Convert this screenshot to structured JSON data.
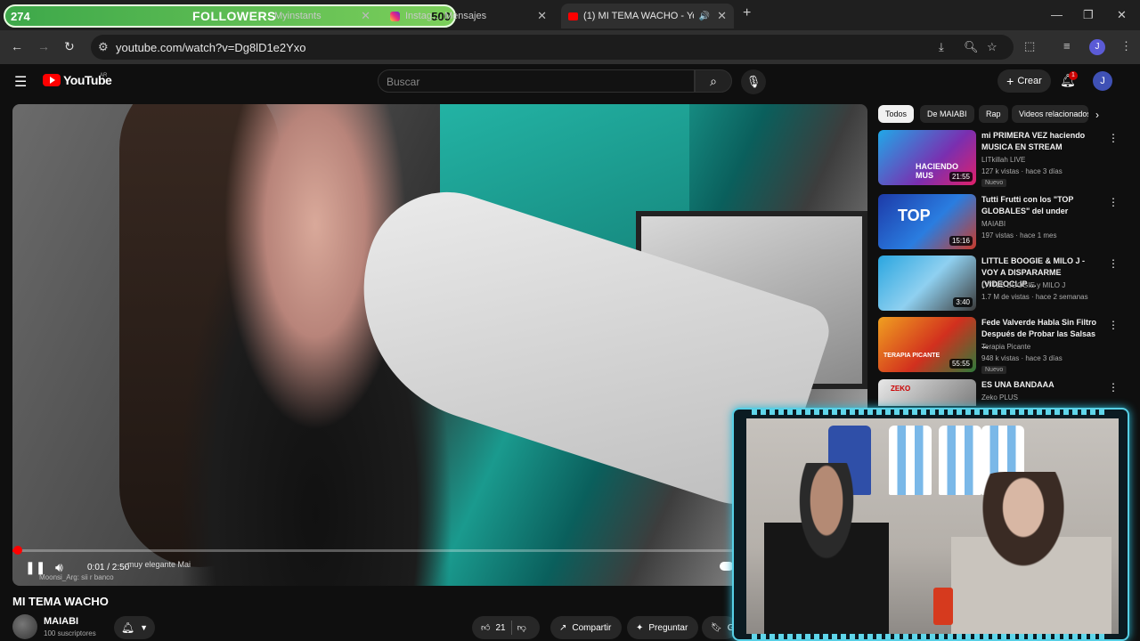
{
  "overlay": {
    "followers_count": "274",
    "followers_label": "FOLLOWERS",
    "followers_goal": "500"
  },
  "tabs": [
    {
      "title": "Myinstants",
      "active": false
    },
    {
      "title": "Instagram • Mensajes",
      "display": "Instag… Mensajes",
      "active": false
    },
    {
      "title": "(1) MI TEMA WACHO - YouTube",
      "display": "(1) MI TEMA WACHO - You",
      "active": true
    }
  ],
  "browser": {
    "url": "youtube.com/watch?v=Dg8lD1e2Yxo",
    "profile_initial": "J"
  },
  "youtube": {
    "logo_text": "YouTube",
    "country": "AR",
    "search_placeholder": "Buscar",
    "create_label": "Crear",
    "notif_count": "1",
    "avatar_initial": "J"
  },
  "player": {
    "time": "0:01 / 2:50",
    "progress_fraction": 0.006,
    "chat_line1": "…muy elegante Mai",
    "chat_line2": "Moonsi_Arg: sii r banco"
  },
  "video": {
    "title": "MI TEMA WACHO",
    "channel": "MAIABI",
    "subscribers": "100 suscriptores",
    "likes": "21",
    "share_label": "Compartir",
    "ask_label": "Preguntar",
    "save_label": "Gu"
  },
  "chips": [
    "Todos",
    "De MAIABI",
    "Rap",
    "Videos relacionados"
  ],
  "recommendations": [
    {
      "title": "mi PRIMERA VEZ haciendo MUSICA EN STREAM",
      "channel": "LITkillah LIVE",
      "meta": "127 k vistas · hace 3 días",
      "badge": "Nuevo",
      "duration": "21:55",
      "thumb_text": "HACIENDO MUS"
    },
    {
      "title": "Tutti Frutti con los \"TOP GLOBALES\" del under",
      "channel": "MAIABI",
      "meta": "197 vistas · hace 1 mes",
      "badge": "",
      "duration": "15:16",
      "thumb_text": "TOP"
    },
    {
      "title": "LITTLE BOOGIE & MILO J - VOY A DISPARARME (VIDEOCLIP ...",
      "channel": "LITTLE BOOGIE y MILO J",
      "meta": "1.7 M de vistas · hace 2 semanas",
      "badge": "",
      "duration": "3:40",
      "thumb_text": ""
    },
    {
      "title": "Fede Valverde Habla Sin Filtro Después de Probar las Salsas ...",
      "channel": "Terapia Picante",
      "meta": "948 k vistas · hace 3 días",
      "badge": "Nuevo",
      "duration": "55:55",
      "thumb_text": "TERAPIA PICANTE"
    },
    {
      "title": "ES UNA BANDAAA",
      "channel": "Zeko PLUS",
      "meta": "",
      "badge": "",
      "duration": "",
      "thumb_text": "ZEKO"
    }
  ],
  "colors": {
    "accent": "#ff0000",
    "overlay_green": "#3da84a",
    "cam_border": "#57d0e6"
  }
}
